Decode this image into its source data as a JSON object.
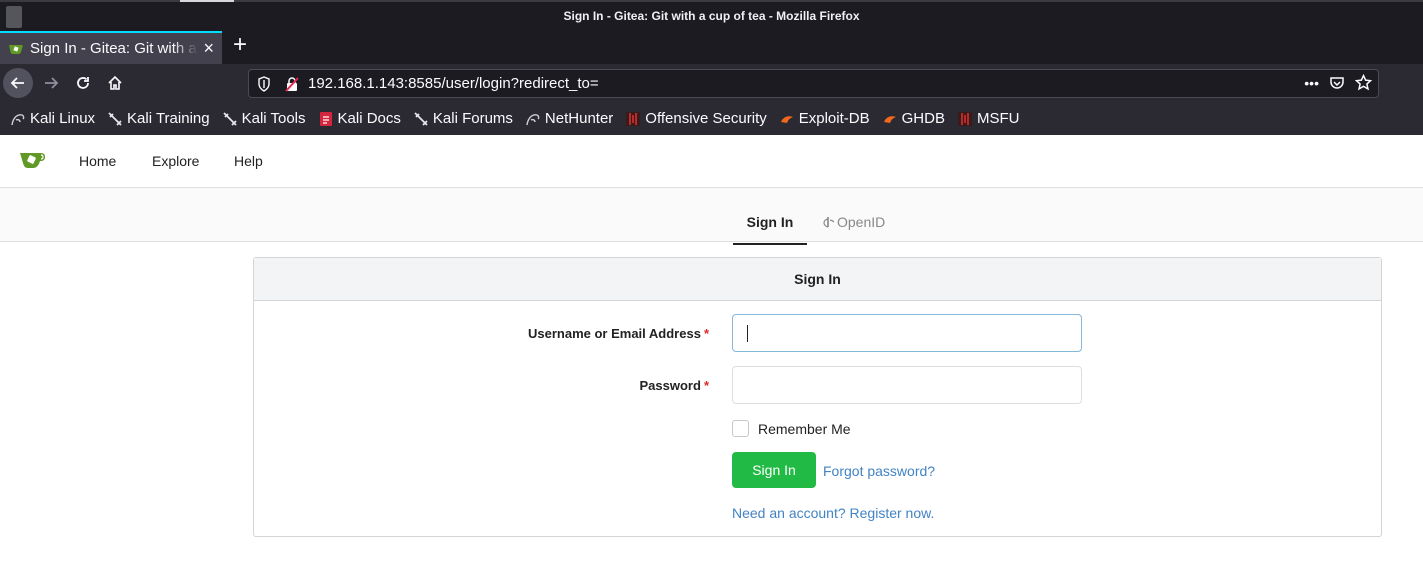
{
  "window": {
    "title": "Sign In - Gitea: Git with a cup of tea - Mozilla Firefox"
  },
  "browser": {
    "tab": {
      "label": "Sign In - Gitea: Git with a cup of tea",
      "close_glyph": "×"
    },
    "new_tab_glyph": "+",
    "url": "192.168.1.143:8585/user/login?redirect_to=",
    "page_actions_glyph": "•••",
    "bookmarks": [
      {
        "label": "Kali Linux",
        "icon": "kali-dragon-icon"
      },
      {
        "label": "Kali Training",
        "icon": "kali-sword-icon"
      },
      {
        "label": "Kali Tools",
        "icon": "kali-sword-icon"
      },
      {
        "label": "Kali Docs",
        "icon": "kali-docs-icon"
      },
      {
        "label": "Kali Forums",
        "icon": "kali-sword-icon"
      },
      {
        "label": "NetHunter",
        "icon": "kali-dragon-icon"
      },
      {
        "label": "Offensive Security",
        "icon": "offsec-icon"
      },
      {
        "label": "Exploit-DB",
        "icon": "exploitdb-icon"
      },
      {
        "label": "GHDB",
        "icon": "exploitdb-icon"
      },
      {
        "label": "MSFU",
        "icon": "offsec-icon"
      }
    ]
  },
  "gitea": {
    "nav": {
      "home": "Home",
      "explore": "Explore",
      "help": "Help"
    },
    "tabs": {
      "signin": "Sign In",
      "openid": "OpenID"
    },
    "form": {
      "header": "Sign In",
      "username_label": "Username or Email Address",
      "password_label": "Password",
      "required_mark": "*",
      "username_value": "",
      "password_value": "",
      "remember_label": "Remember Me",
      "remember_checked": false,
      "submit_label": "Sign In",
      "forgot_link": "Forgot password?",
      "register_link": "Need an account? Register now."
    },
    "colors": {
      "primary_button": "#21ba45",
      "link": "#4183c4",
      "required": "#db2828",
      "logo_green": "#609926"
    }
  }
}
